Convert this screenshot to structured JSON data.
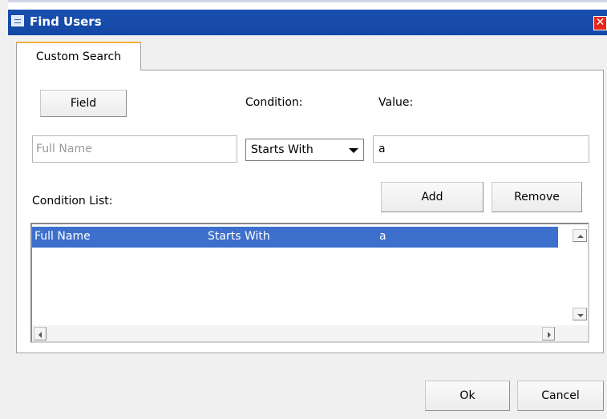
{
  "window": {
    "title": "Find Users",
    "close_glyph": "✕"
  },
  "tabs": [
    {
      "label": "Custom Search",
      "selected": true
    }
  ],
  "form": {
    "field_button": "Field",
    "condition_label": "Condition:",
    "value_label": "Value:",
    "field_placeholder": "Full Name",
    "condition_selected": "Starts With",
    "value_input": "a",
    "condition_list_label": "Condition List:",
    "add_button": "Add",
    "remove_button": "Remove"
  },
  "condition_list": [
    {
      "field": "Full Name",
      "condition": "Starts With",
      "value": "a",
      "selected": true
    }
  ],
  "footer": {
    "ok_button": "Ok",
    "cancel_button": "Cancel"
  },
  "colors": {
    "title_bar": "#1a4fae",
    "selection": "#3d6fcc",
    "close_button": "#e8271c",
    "tab_accent": "#f0b23a"
  }
}
